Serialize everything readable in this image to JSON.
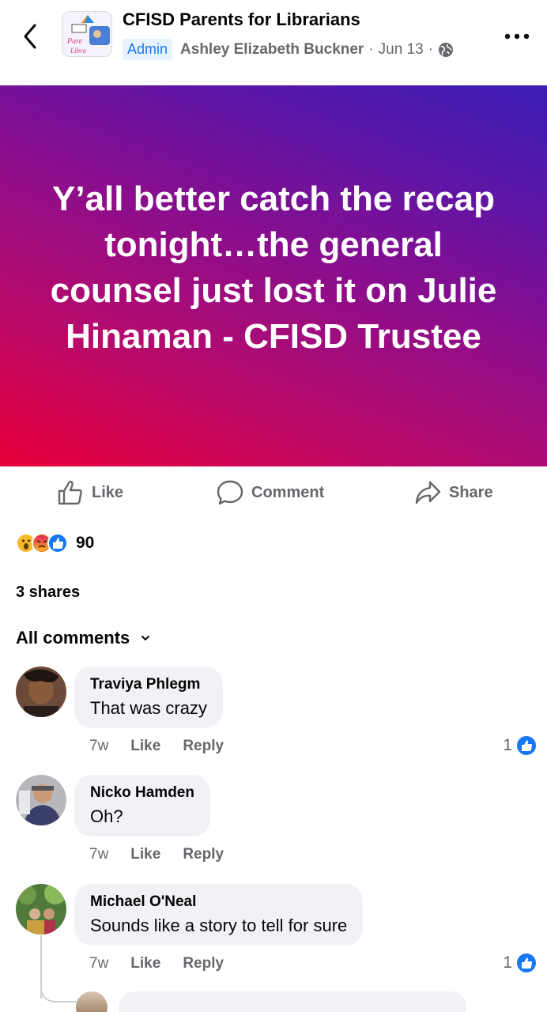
{
  "header": {
    "group_name": "CFISD Parents for Librarians",
    "admin_badge": "Admin",
    "author": "Ashley Elizabeth Buckner",
    "separator": "·",
    "date": "Jun 13",
    "privacy_icon": "globe-icon",
    "back_icon": "chevron-left-icon",
    "more_icon": "more-horizontal-icon"
  },
  "post": {
    "text": "Y’all better catch the recap tonight…the general counsel just lost it on Julie Hinaman - CFISD Trustee",
    "gradient": [
      "#e8003a",
      "#8a0e8d",
      "#3a1cb4"
    ]
  },
  "actions": {
    "like": "Like",
    "comment": "Comment",
    "share": "Share"
  },
  "reactions": {
    "types": [
      "wow",
      "angry",
      "like"
    ],
    "count": "90"
  },
  "shares": "3 shares",
  "comments_filter": "All comments",
  "comments": [
    {
      "name": "Traviya Phlegm",
      "text": "That was crazy",
      "time": "7w",
      "like": "Like",
      "reply": "Reply",
      "reaction_count": "1"
    },
    {
      "name": "Nicko Hamden",
      "text": "Oh?",
      "time": "7w",
      "like": "Like",
      "reply": "Reply",
      "reaction_count": ""
    },
    {
      "name": "Michael O'Neal",
      "text": "Sounds like a story to tell for sure",
      "time": "7w",
      "like": "Like",
      "reply": "Reply",
      "reaction_count": "1"
    }
  ],
  "colors": {
    "brand_blue": "#1877f2",
    "secondary_text": "#65676b",
    "bubble_bg": "#f0f2f5"
  }
}
